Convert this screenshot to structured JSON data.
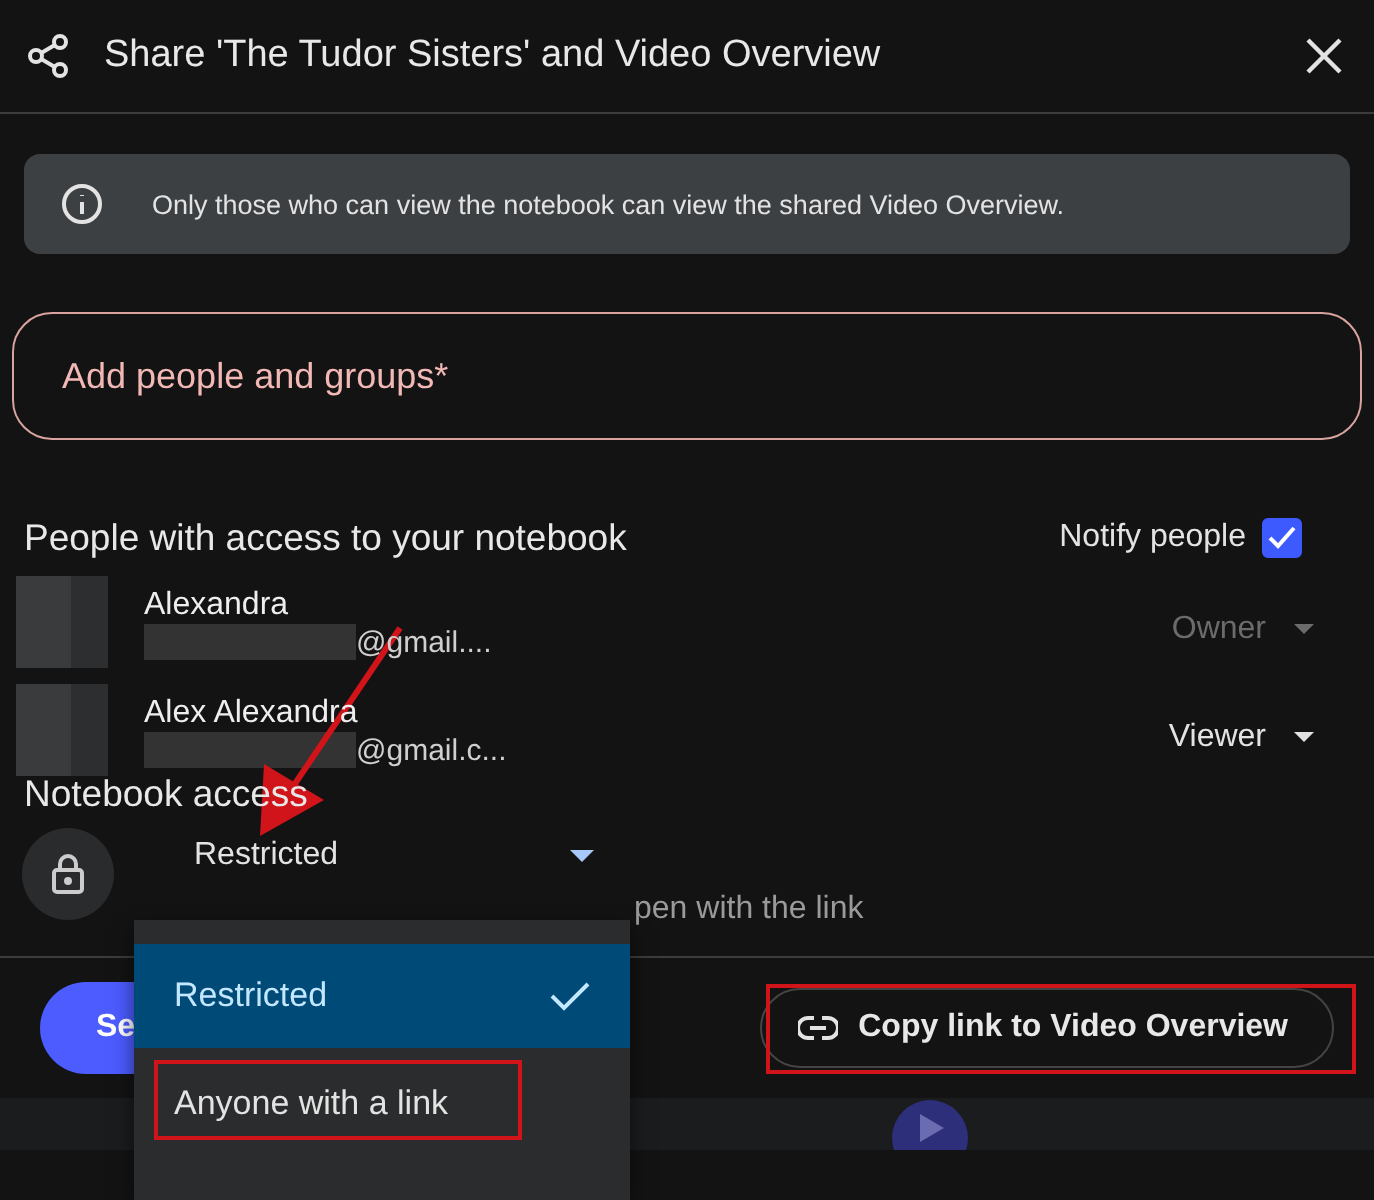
{
  "dialog": {
    "title": "Share 'The Tudor Sisters' and Video Overview"
  },
  "notice": "Only those who can view the notebook can view the shared Video Overview.",
  "people_field": {
    "placeholder": "Add people and groups*"
  },
  "people_section": {
    "heading": "People with access to your notebook",
    "notify_label": "Notify people",
    "notify_checked": true
  },
  "people": [
    {
      "name": "Alexandra",
      "email": "@gmail....",
      "role": "Owner",
      "disabled": true
    },
    {
      "name": "Alex Alexandra",
      "email": "@gmail.c...",
      "role": "Viewer",
      "disabled": false
    }
  ],
  "access": {
    "heading": "Notebook access",
    "value": "Restricted",
    "helper": "pen with the link"
  },
  "access_menu": [
    {
      "label": "Restricted",
      "selected": true,
      "highlighted": false
    },
    {
      "label": "Anyone with a link",
      "selected": false,
      "highlighted": true
    }
  ],
  "footer": {
    "send_label": "Se",
    "copy_label": "Copy link to Video Overview",
    "copy_highlighted": true
  }
}
